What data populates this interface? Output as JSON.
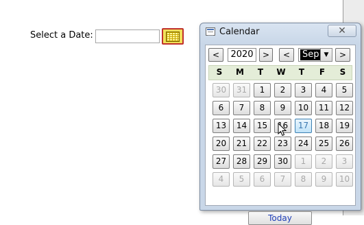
{
  "form": {
    "label": "Select a Date:",
    "date_value": "",
    "picker_button_icon": "calendar-grid-icon"
  },
  "window": {
    "title": "Calendar",
    "close_glyph": "✕",
    "nav": {
      "prev_year": "<",
      "year": "2020",
      "next_year": ">",
      "prev_month": "<",
      "month": "Sep",
      "dropdown_glyph": "▼",
      "next_month": ">"
    },
    "weekdays": [
      "S",
      "M",
      "T",
      "W",
      "T",
      "F",
      "S"
    ],
    "days": [
      "30",
      "31",
      "1",
      "2",
      "3",
      "4",
      "5",
      "6",
      "7",
      "8",
      "9",
      "10",
      "11",
      "12",
      "13",
      "14",
      "15",
      "16",
      "17",
      "18",
      "19",
      "20",
      "21",
      "22",
      "23",
      "24",
      "25",
      "26",
      "27",
      "28",
      "29",
      "30",
      "1",
      "2",
      "3",
      "4",
      "5",
      "6",
      "7",
      "8",
      "9",
      "10"
    ],
    "other_month": [
      0,
      1,
      32,
      33,
      34,
      35,
      36,
      37,
      38,
      39,
      40,
      41
    ],
    "hovered_index": 18,
    "today_label": "Today"
  },
  "colors": {
    "accent_button": "#f1e15a",
    "accent_border": "#c0302c",
    "weekday_bar": "#e4edd8",
    "today_text": "#1f3fb8"
  }
}
